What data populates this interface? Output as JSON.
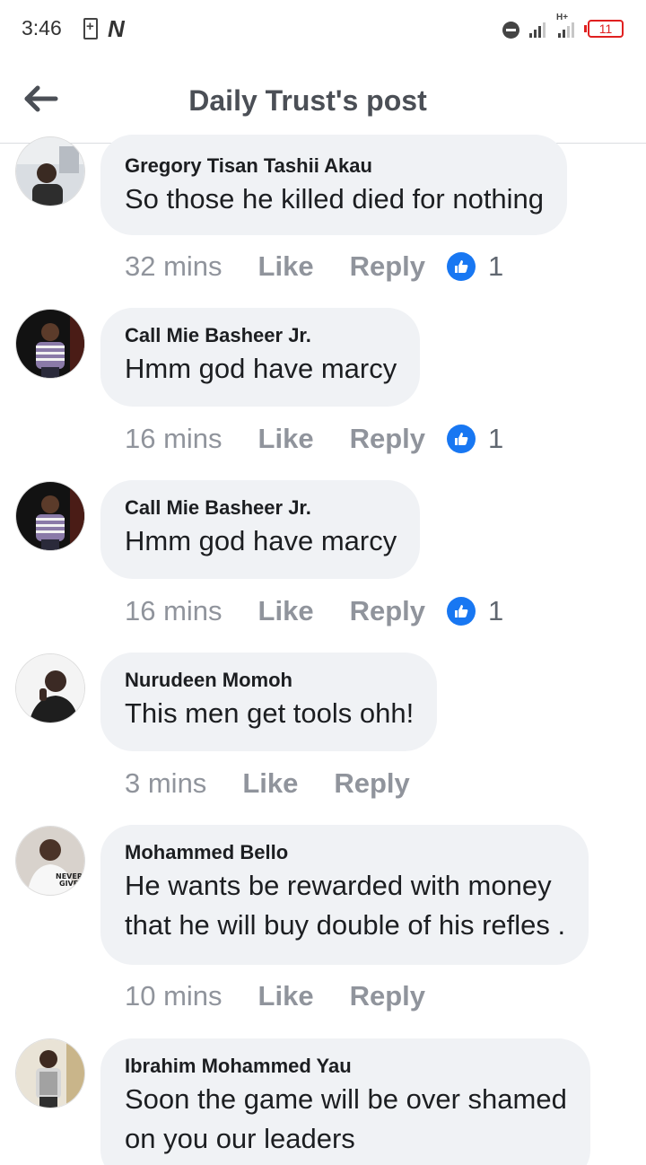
{
  "status_bar": {
    "time": "3:46",
    "n_icon": "N",
    "network": "H+",
    "battery": "11"
  },
  "header": {
    "title": "Daily Trust's post"
  },
  "comments": [
    {
      "author": "Gregory Tisan Tashii Akau",
      "lines": [
        "So those he killed died for nothing"
      ],
      "time": "32 mins",
      "like": "Like",
      "reply": "Reply",
      "reactions": "1"
    },
    {
      "author": "Call Mie Basheer Jr.",
      "lines": [
        "Hmm god have marcy"
      ],
      "time": "16 mins",
      "like": "Like",
      "reply": "Reply",
      "reactions": "1"
    },
    {
      "author": "Call Mie Basheer Jr.",
      "lines": [
        "Hmm god have marcy"
      ],
      "time": "16 mins",
      "like": "Like",
      "reply": "Reply",
      "reactions": "1"
    },
    {
      "author": "Nurudeen Momoh",
      "lines": [
        "This men get tools ohh!"
      ],
      "time": "3 mins",
      "like": "Like",
      "reply": "Reply"
    },
    {
      "author": "Mohammed Bello",
      "lines": [
        "He wants be rewarded with money",
        "that he will buy double of his refles ."
      ],
      "time": "10 mins",
      "like": "Like",
      "reply": "Reply"
    },
    {
      "author": "Ibrahim Mohammed Yau",
      "lines": [
        "Soon the game will be over shamed",
        "on you our leaders"
      ]
    }
  ],
  "icons": {
    "back": "back-arrow-icon",
    "like_reaction": "thumbs-up-icon"
  },
  "colors": {
    "bubble": "#f0f2f5",
    "meta_text": "#90949c",
    "like_blue": "#1877f2",
    "header_title": "#4b4f56"
  }
}
